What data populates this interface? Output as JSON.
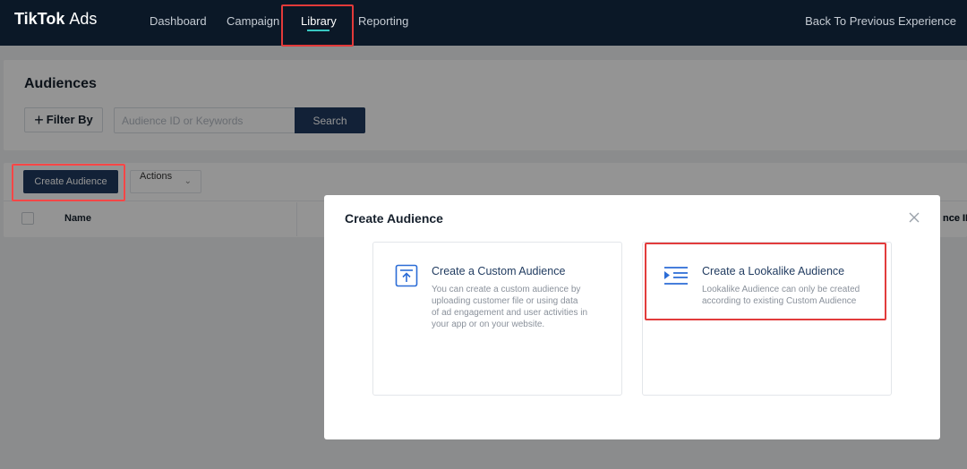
{
  "nav": {
    "brand_bold": "TikTok",
    "brand_light": "Ads",
    "items": [
      {
        "label": "Dashboard"
      },
      {
        "label": "Campaign"
      },
      {
        "label": "Library"
      },
      {
        "label": "Reporting"
      }
    ],
    "back_link": "Back To Previous Experience",
    "active_item": "Library"
  },
  "page": {
    "title": "Audiences",
    "filter_label": "Filter By",
    "search_placeholder": "Audience ID or Keywords",
    "search_button": "Search",
    "create_button": "Create Audience",
    "actions_label": "Actions"
  },
  "table": {
    "columns": [
      "Name",
      "nce ID"
    ]
  },
  "modal": {
    "title": "Create Audience",
    "options": [
      {
        "icon": "upload-icon",
        "title": "Create a Custom Audience",
        "description": [
          "You can create a custom audience by",
          "uploading customer file or using data",
          "of ad engagement and user activities in",
          "your app or on your website."
        ]
      },
      {
        "icon": "indent-list-icon",
        "title": "Create a Lookalike Audience",
        "description": [
          "Lookalike Audience can only be created",
          "according to existing Custom Audience"
        ]
      }
    ]
  },
  "colors": {
    "nav_bg": "#0b1827",
    "primary": "#1f3a5f",
    "accent": "#38c7c1",
    "icon_blue": "#2b6cd6",
    "highlight": "#e33a3a"
  }
}
